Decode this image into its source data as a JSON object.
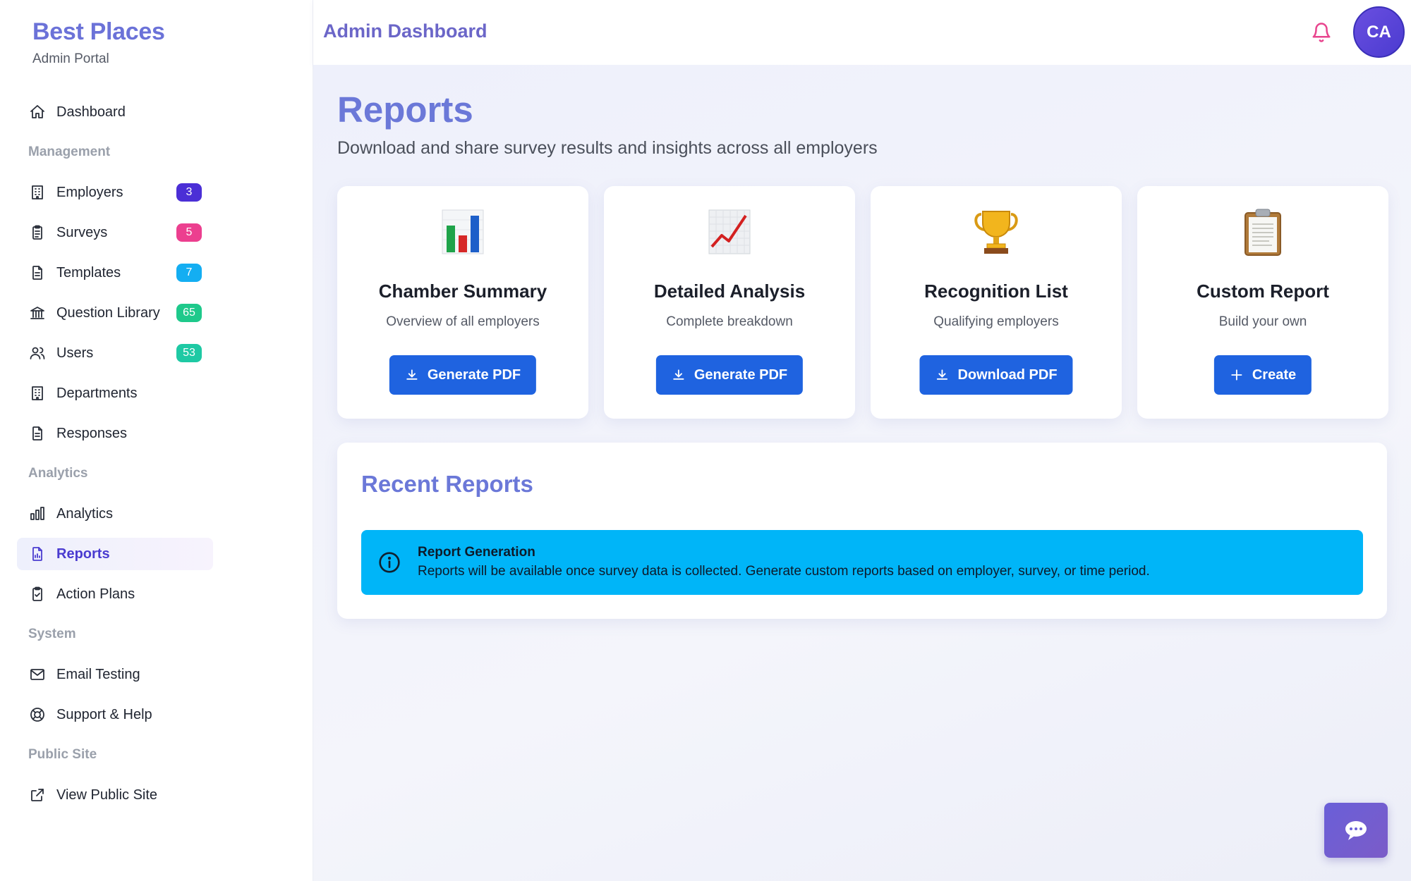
{
  "brand": {
    "title": "Best Places",
    "subtitle": "Admin Portal"
  },
  "sidebar": {
    "items": [
      {
        "type": "item",
        "label": "Dashboard",
        "icon": "home-icon"
      },
      {
        "type": "section",
        "label": "Management"
      },
      {
        "type": "item",
        "label": "Employers",
        "icon": "building-icon",
        "badge": "3",
        "badge_color": "#4b2fd6"
      },
      {
        "type": "item",
        "label": "Surveys",
        "icon": "clipboard-icon",
        "badge": "5",
        "badge_color": "#ec3f8f"
      },
      {
        "type": "item",
        "label": "Templates",
        "icon": "document-icon",
        "badge": "7",
        "badge_color": "#14aef2"
      },
      {
        "type": "item",
        "label": "Question Library",
        "icon": "library-icon",
        "badge": "65",
        "badge_color": "#1ec98b"
      },
      {
        "type": "item",
        "label": "Users",
        "icon": "users-icon",
        "badge": "53",
        "badge_color": "#1ec9a4"
      },
      {
        "type": "item",
        "label": "Departments",
        "icon": "building-icon"
      },
      {
        "type": "item",
        "label": "Responses",
        "icon": "document-icon"
      },
      {
        "type": "section",
        "label": "Analytics"
      },
      {
        "type": "item",
        "label": "Analytics",
        "icon": "bar-chart-icon"
      },
      {
        "type": "item",
        "label": "Reports",
        "icon": "report-icon",
        "active": true
      },
      {
        "type": "item",
        "label": "Action Plans",
        "icon": "clipboard-check-icon"
      },
      {
        "type": "section",
        "label": "System"
      },
      {
        "type": "item",
        "label": "Email Testing",
        "icon": "mail-icon"
      },
      {
        "type": "item",
        "label": "Support & Help",
        "icon": "lifebuoy-icon"
      },
      {
        "type": "section",
        "label": "Public Site"
      },
      {
        "type": "item",
        "label": "View Public Site",
        "icon": "external-link-icon"
      }
    ]
  },
  "header": {
    "title": "Admin Dashboard",
    "avatar_initials": "CA",
    "bell_icon": "bell-icon"
  },
  "main": {
    "title": "Reports",
    "subtitle": "Download and share survey results and insights across all employers",
    "cards": [
      {
        "icon": "bar-chart-emoji-icon",
        "title": "Chamber Summary",
        "desc": "Overview of all employers",
        "button": "Generate PDF",
        "button_icon": "download-icon"
      },
      {
        "icon": "line-chart-emoji-icon",
        "title": "Detailed Analysis",
        "desc": "Complete breakdown",
        "button": "Generate PDF",
        "button_icon": "download-icon"
      },
      {
        "icon": "trophy-icon",
        "title": "Recognition List",
        "desc": "Qualifying employers",
        "button": "Download PDF",
        "button_icon": "download-icon"
      },
      {
        "icon": "clipboard-emoji-icon",
        "title": "Custom Report",
        "desc": "Build your own",
        "button": "Create",
        "button_icon": "plus-icon"
      }
    ],
    "recent": {
      "title": "Recent Reports",
      "alert_title": "Report Generation",
      "alert_text": "Reports will be available once survey data is collected. Generate custom reports based on employer, survey, or time period."
    }
  },
  "colors": {
    "accent": "#6b78d8",
    "button": "#1f63e0",
    "alert": "#00b5f8"
  }
}
